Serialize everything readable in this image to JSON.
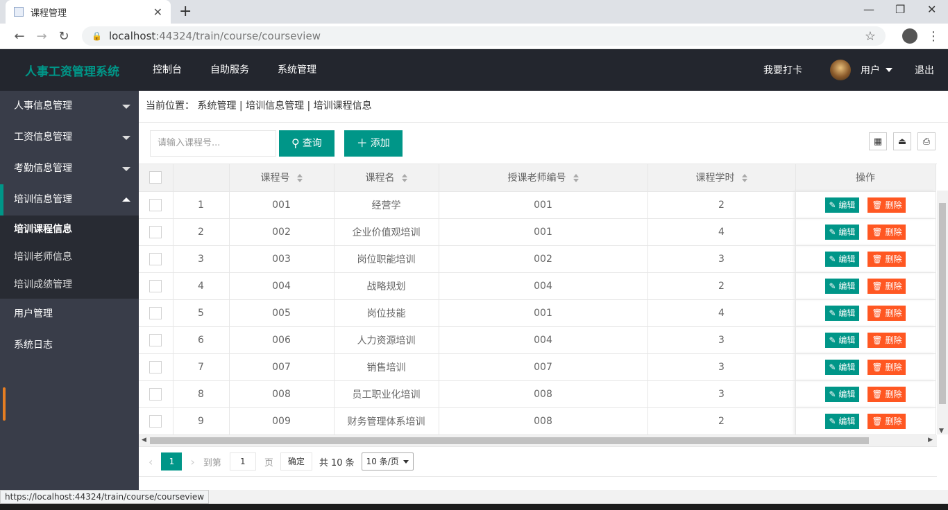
{
  "browser": {
    "tab_title": "课程管理",
    "tab_close": "✕",
    "new_tab": "+",
    "url_host": "localhost",
    "url_rest": ":44324/train/course/courseview",
    "status_url": "https://localhost:44324/train/course/courseview"
  },
  "header": {
    "logo": "人事工资管理系统",
    "nav": [
      "控制台",
      "自助服务",
      "系统管理"
    ],
    "clockin": "我要打卡",
    "user": "用户",
    "logout": "退出"
  },
  "sidebar": {
    "items": [
      {
        "label": "人事信息管理"
      },
      {
        "label": "工资信息管理"
      },
      {
        "label": "考勤信息管理"
      },
      {
        "label": "培训信息管理"
      }
    ],
    "sub_items": [
      "培训课程信息",
      "培训老师信息",
      "培训成绩管理"
    ],
    "bottom_items": [
      "用户管理",
      "系统日志"
    ]
  },
  "breadcrumb": "当前位置： 系统管理 | 培训信息管理 | 培训课程信息",
  "toolbar": {
    "search_placeholder": "请输入课程号...",
    "query_label": "查询",
    "add_label": "添加"
  },
  "table": {
    "headers": [
      "课程号",
      "课程名",
      "授课老师编号",
      "课程学时",
      "操作"
    ],
    "edit_label": "编辑",
    "delete_label": "删除",
    "rows": [
      [
        "1",
        "001",
        "经营学",
        "001",
        "2"
      ],
      [
        "2",
        "002",
        "企业价值观培训",
        "001",
        "4"
      ],
      [
        "3",
        "003",
        "岗位职能培训",
        "002",
        "3"
      ],
      [
        "4",
        "004",
        "战略规划",
        "004",
        "2"
      ],
      [
        "5",
        "005",
        "岗位技能",
        "001",
        "4"
      ],
      [
        "6",
        "006",
        "人力资源培训",
        "004",
        "3"
      ],
      [
        "7",
        "007",
        "销售培训",
        "007",
        "3"
      ],
      [
        "8",
        "008",
        "员工职业化培训",
        "008",
        "3"
      ],
      [
        "9",
        "009",
        "财务管理体系培训",
        "008",
        "2"
      ]
    ]
  },
  "pager": {
    "current": "1",
    "goto_label": "到第",
    "goto_value": "1",
    "page_unit": "页",
    "confirm": "确定",
    "total": "共 10 条",
    "page_size": "10 条/页"
  },
  "colors": {
    "accent": "#009688",
    "danger": "#ff5722",
    "sidebar": "#393d49",
    "header": "#23262e"
  }
}
